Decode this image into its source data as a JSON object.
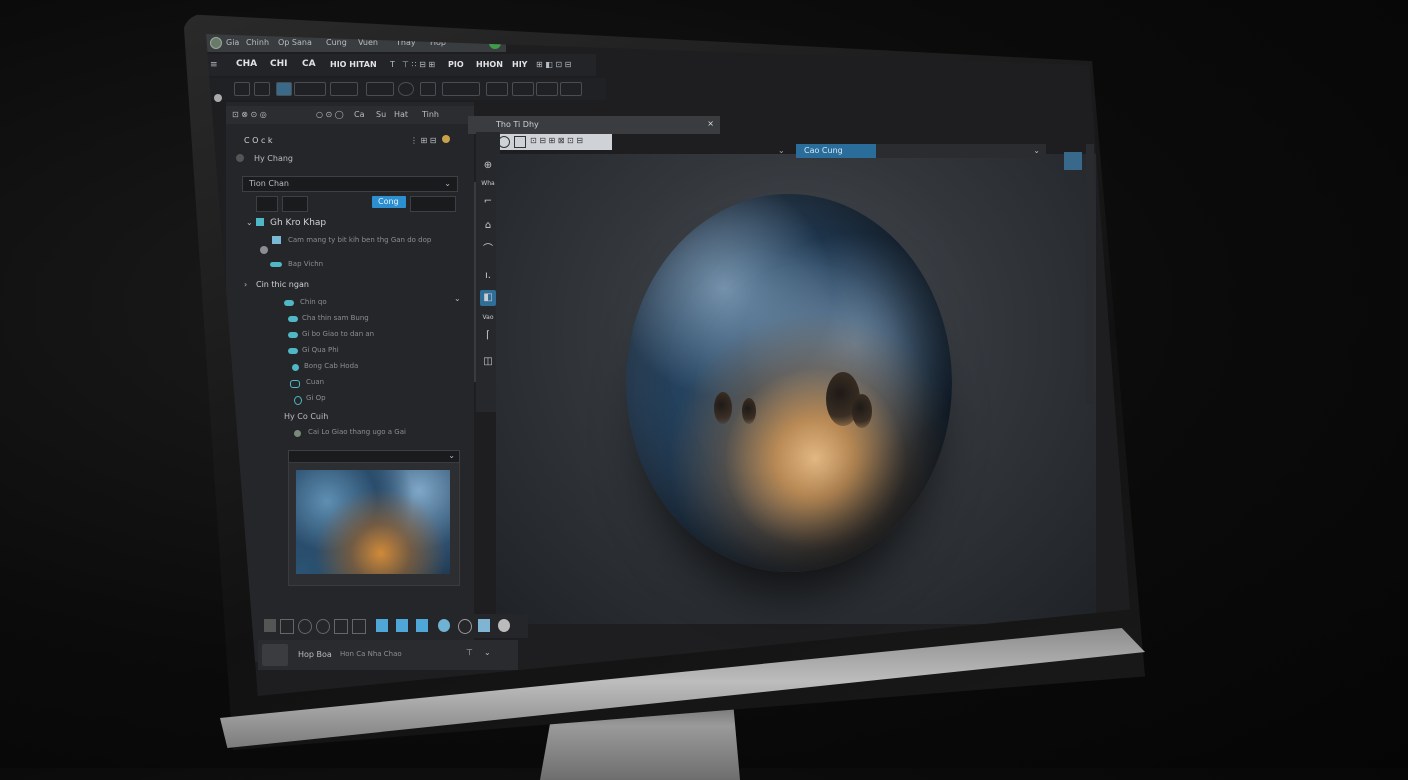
{
  "menubar": {
    "items": [
      "Gia",
      "Chinh",
      "Op Sana",
      "Cung",
      "Vuen",
      "Thay",
      "Hop"
    ],
    "status_icon": "green-circle-icon"
  },
  "toolbar": {
    "labels": [
      "CHA",
      "CHI",
      "CA",
      "HIO HITAN",
      "T",
      "PIO",
      "HHON",
      "HIY"
    ]
  },
  "left_panel": {
    "tabs": [
      "Ca",
      "Su",
      "Hat",
      "Tinh"
    ],
    "header": "C O c k",
    "subheader": "Hy Chang",
    "dropdown_label": "Tion Chan",
    "apply_button": "Cong",
    "group1_title": "Gh Kro Khap",
    "group1_items": [
      "Cam mang ty bit kih ben thg Gan do dop",
      "Bap Vichn"
    ],
    "group2_title": "Cin thic ngan",
    "group2_items": [
      "Chin qo",
      "Cha thin sam Bung",
      "Gi bo Giao to dan an",
      "Gi Qua Phi",
      "Bong Cab Hoda",
      "Cuan",
      "Gi Op"
    ],
    "group3_title": "Hy Co Cuih",
    "group3_items": [
      "Cai Lo Giao thang ugo a Gai"
    ]
  },
  "canvas_dialog": {
    "title": "Tho Ti Dhy"
  },
  "vertical_tools": [
    "⊕",
    "Wha",
    "⌐",
    "⌂",
    "⌒",
    "ı.",
    "◧",
    "Vao",
    "⌈",
    "◫"
  ],
  "top_right_bar": {
    "tab_label": "Cao Cung"
  },
  "bottom_bar": {
    "username": "Hop Boa",
    "status": "Hon Ca Nha Chao"
  },
  "colors": {
    "accent": "#2c8fd0",
    "teal": "#4fb7c6",
    "background": "#1e1e20"
  }
}
